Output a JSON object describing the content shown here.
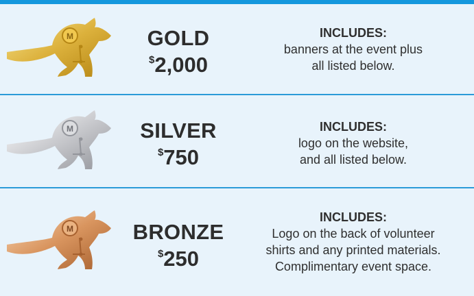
{
  "tiers": [
    {
      "name": "GOLD",
      "price_symbol": "$",
      "price_value": "2,000",
      "heading": "INCLUDES:",
      "lines": [
        "banners at the event plus",
        "all listed below."
      ],
      "medal_colors": {
        "light": "#f7e38c",
        "mid": "#dcb13c",
        "dark": "#b58614",
        "accent": "#f1c84f"
      }
    },
    {
      "name": "SILVER",
      "price_symbol": "$",
      "price_value": "750",
      "heading": "INCLUDES:",
      "lines": [
        "logo on the website,",
        "and all listed below."
      ],
      "medal_colors": {
        "light": "#ffffff",
        "mid": "#c9cace",
        "dark": "#93959b",
        "accent": "#dcdde0"
      }
    },
    {
      "name": "BRONZE",
      "price_symbol": "$",
      "price_value": "250",
      "heading": "INCLUDES:",
      "lines": [
        "Logo on the back of volunteer",
        "shirts and any printed materials.",
        "Complimentary event space."
      ],
      "medal_colors": {
        "light": "#f9d7b5",
        "mid": "#d9955f",
        "dark": "#a7612f",
        "accent": "#eab382"
      }
    }
  ],
  "mascot_icon": "kangaroo-medal-icon",
  "badge_letter": "M",
  "colors": {
    "accent_blue": "#1497dd",
    "background": "#e8f3fb",
    "text": "#2d2d2d"
  }
}
